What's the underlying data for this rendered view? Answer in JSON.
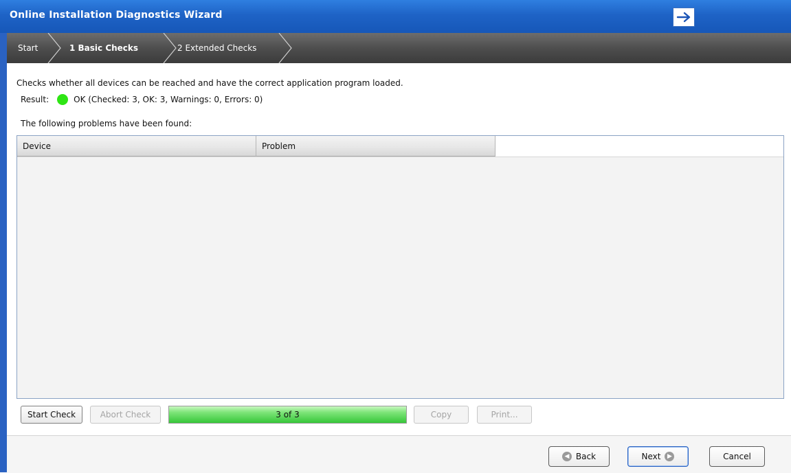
{
  "window": {
    "title": "Online Installation Diagnostics Wizard"
  },
  "breadcrumb": {
    "items": [
      {
        "label": "Start"
      },
      {
        "label": "1 Basic Checks"
      },
      {
        "label": "2 Extended Checks"
      }
    ]
  },
  "content": {
    "description": "Checks whether all devices can be reached and have the correct application program loaded.",
    "result_label": "Result:",
    "result_text": "OK (Checked: 3, OK: 3, Warnings: 0, Errors: 0)",
    "problems_label": "The following problems have been found:",
    "table": {
      "columns": [
        "Device",
        "Problem"
      ],
      "rows": []
    }
  },
  "toolbar": {
    "start_check": "Start Check",
    "abort_check": "Abort Check",
    "progress_text": "3 of 3",
    "progress_value": 1.0,
    "copy": "Copy",
    "print": "Print..."
  },
  "footer": {
    "back": "Back",
    "next": "Next",
    "cancel": "Cancel"
  },
  "colors": {
    "accent": "#1e63c6",
    "ok_status": "#2ee514"
  },
  "icons": {
    "title_action": "arrow-right-icon",
    "back": "back-arrow-icon",
    "next": "next-arrow-icon"
  }
}
